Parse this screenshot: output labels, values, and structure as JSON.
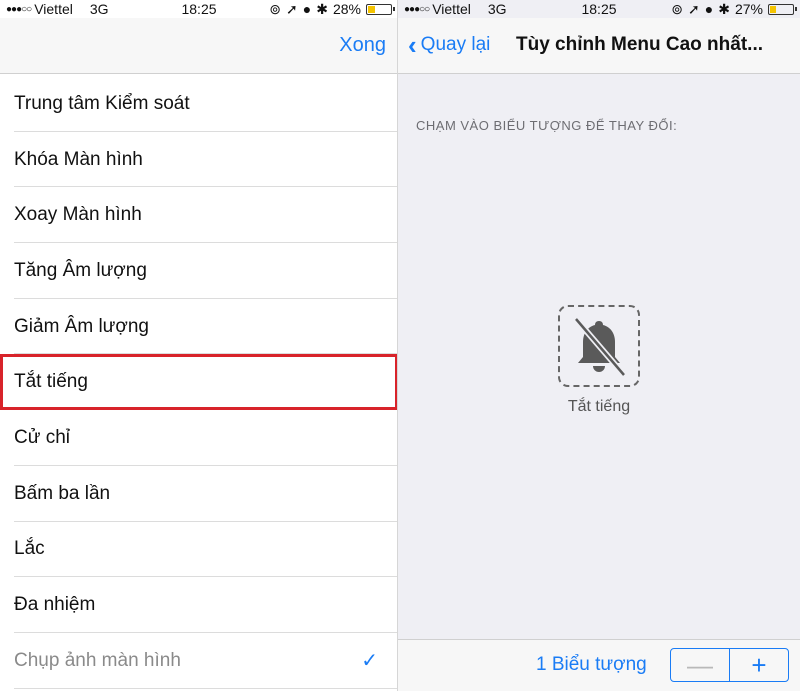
{
  "left_status": {
    "carrier": "Viettel",
    "network": "3G",
    "time": "18:25",
    "battery": "28%",
    "battery_level": 0.28
  },
  "right_status": {
    "carrier": "Viettel",
    "network": "3G",
    "time": "18:25",
    "battery": "27%",
    "battery_level": 0.27
  },
  "left_nav": {
    "done_label": "Xong"
  },
  "right_nav": {
    "back_label": "Quay lại",
    "title": "Tùy chỉnh Menu Cao nhất..."
  },
  "actions_list": [
    {
      "label": "Trung tâm Kiểm soát"
    },
    {
      "label": "Khóa Màn hình"
    },
    {
      "label": "Xoay Màn hình"
    },
    {
      "label": "Tăng Âm lượng"
    },
    {
      "label": "Giảm Âm lượng"
    },
    {
      "label": "Tắt tiếng",
      "selected": true
    },
    {
      "label": "Cử chỉ"
    },
    {
      "label": "Bấm ba lần"
    },
    {
      "label": "Lắc"
    },
    {
      "label": "Đa nhiệm"
    },
    {
      "label": "Chụp ảnh màn hình",
      "checked": true,
      "dimmed": true
    }
  ],
  "customize": {
    "instruction": "CHẠM VÀO BIỂU TƯỢNG ĐỂ THAY ĐỔI:",
    "icon_name": "mute-bell-icon",
    "icon_label": "Tắt tiếng",
    "count_label": "1 Biểu tượng",
    "minus_symbol": "—",
    "plus_symbol": "+"
  },
  "colors": {
    "accent": "#1a7cf5",
    "highlight": "#d8232a",
    "battery": "#f5c400"
  }
}
